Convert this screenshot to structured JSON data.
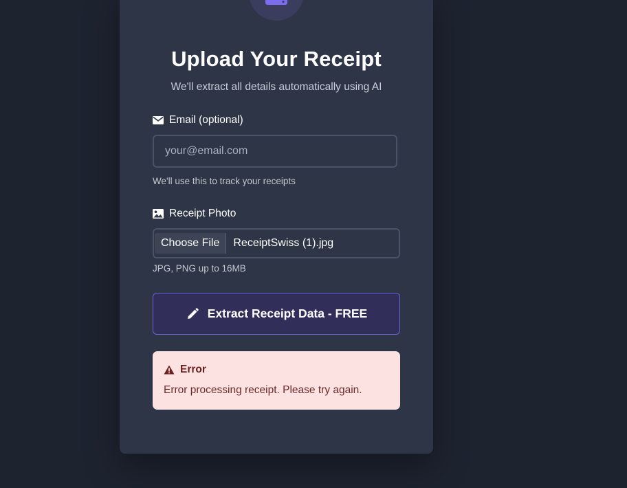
{
  "colors": {
    "background": "#1e2330",
    "card": "#2e3546",
    "accent": "#6c63d6",
    "icon_accent": "#7b6cf0",
    "error_bg": "#fde2e2",
    "error_text": "#6b1f1f"
  },
  "header": {
    "icon": "upload-icon",
    "title": "Upload Your Receipt",
    "subtitle": "We'll extract all details automatically using AI"
  },
  "email": {
    "icon": "envelope-icon",
    "label": "Email (optional)",
    "value": "",
    "placeholder": "your@email.com",
    "hint": "We'll use this to track your receipts"
  },
  "photo": {
    "icon": "image-icon",
    "label": "Receipt Photo",
    "button_label": "Choose File",
    "file_name": "ReceiptSwiss (1).jpg",
    "hint": "JPG, PNG up to 16MB"
  },
  "submit": {
    "icon": "pencil-icon",
    "label": "Extract Receipt Data - FREE"
  },
  "error": {
    "icon": "warning-icon",
    "title": "Error",
    "message": "Error processing receipt. Please try again."
  }
}
